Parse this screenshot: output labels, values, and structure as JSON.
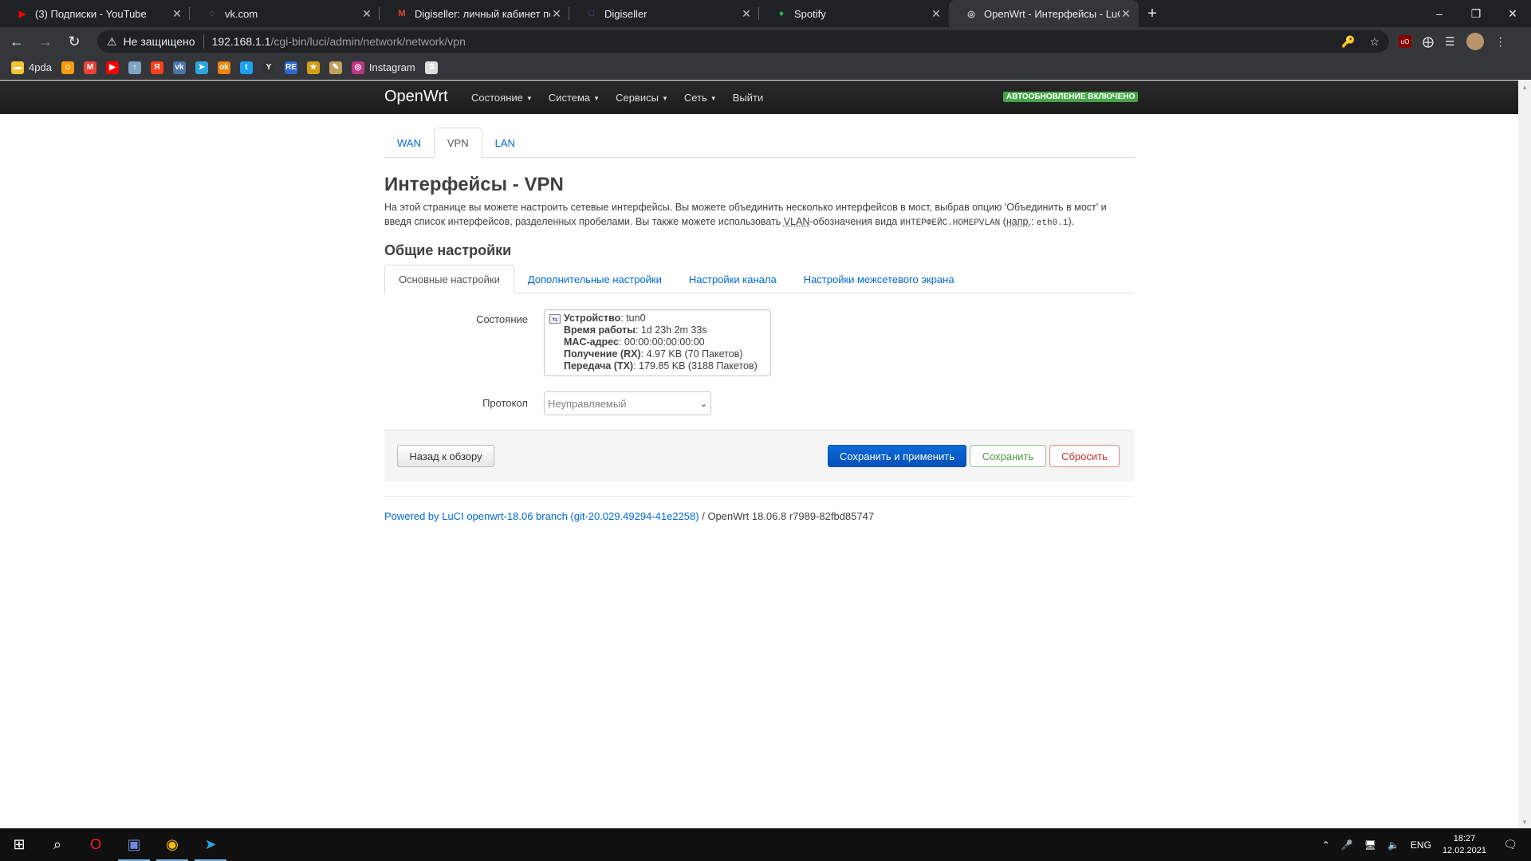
{
  "browser": {
    "tabs": [
      {
        "title": "(3) Подписки - YouTube",
        "icon": "youtube-icon",
        "color": "#ff0000"
      },
      {
        "title": "vk.com",
        "icon": "loading-icon",
        "color": "#9aa0a6"
      },
      {
        "title": "Digiseller: личный кабинет поку",
        "icon": "gmail-icon",
        "color": "#ea4335"
      },
      {
        "title": "Digiseller",
        "icon": "digiseller-icon",
        "color": "#3a5bbf"
      },
      {
        "title": "Spotify",
        "icon": "spotify-icon",
        "color": "#1db954"
      },
      {
        "title": "OpenWrt - Интерфейсы - LuCI",
        "icon": "openwrt-icon",
        "color": "#cccccc"
      }
    ],
    "address": {
      "security_label": "Не защищено",
      "host": "192.168.1.1",
      "path": "/cgi-bin/luci/admin/network/network/vpn"
    },
    "bookmarks": [
      {
        "label": "4pda",
        "icon": "folder-icon",
        "color": "#f4c430"
      },
      {
        "label": "",
        "icon": "sticker-icon",
        "color": "#f39c12"
      },
      {
        "label": "",
        "icon": "gmail-icon",
        "color": "#ea4335"
      },
      {
        "label": "",
        "icon": "youtube-icon",
        "color": "#ff0000"
      },
      {
        "label": "",
        "icon": "upload-icon",
        "color": "#7fa4c4"
      },
      {
        "label": "",
        "icon": "yandex-icon",
        "color": "#fc3f1d"
      },
      {
        "label": "",
        "icon": "vk-icon",
        "color": "#4a76a8"
      },
      {
        "label": "",
        "icon": "telegram-icon",
        "color": "#2ca5e0"
      },
      {
        "label": "",
        "icon": "odnoklassniki-icon",
        "color": "#ee8208"
      },
      {
        "label": "",
        "icon": "twitter-icon",
        "color": "#1da1f2"
      },
      {
        "label": "",
        "icon": "y-icon",
        "color": "#333333"
      },
      {
        "label": "",
        "icon": "re-icon",
        "color": "#3366cc"
      },
      {
        "label": "",
        "icon": "emblem-icon",
        "color": "#d4a017"
      },
      {
        "label": "",
        "icon": "pen-icon",
        "color": "#c0a060"
      },
      {
        "label": "Instagram",
        "icon": "instagram-icon",
        "color": "#c13584"
      },
      {
        "label": "",
        "icon": "flask-icon",
        "color": "#dddddd"
      }
    ]
  },
  "luci": {
    "brand": "OpenWrt",
    "menu": [
      {
        "label": "Состояние",
        "caret": true
      },
      {
        "label": "Система",
        "caret": true
      },
      {
        "label": "Сервисы",
        "caret": true
      },
      {
        "label": "Сеть",
        "caret": true
      },
      {
        "label": "Выйти",
        "caret": false
      }
    ],
    "autoupdate_badge": "АВТООБНОВЛЕНИЕ ВКЛЮЧЕНО",
    "iface_tabs": [
      "WAN",
      "VPN",
      "LAN"
    ],
    "iface_tab_active": "VPN",
    "title": "Интерфейсы - VPN",
    "description": {
      "part1": "На этой странице вы можете настроить сетевые интерфейсы. Вы можете объединить несколько интерфейсов в мост, выбрав опцию 'Объединить в мост' и введя список интерфейсов, разделенных пробелами. Вы также можете использовать ",
      "vlan": "VLAN",
      "part2": "-обозначения вида ",
      "code1": "ИНТЕРФЕЙС.НОМЕРVLAN",
      "part3": " (",
      "abbr": "напр.",
      "part4": ": ",
      "code2": "eth0.1",
      "part5": ")."
    },
    "section_title": "Общие настройки",
    "sub_tabs": [
      "Основные настройки",
      "Дополнительные настройки",
      "Настройки канала",
      "Настройки межсетевого экрана"
    ],
    "sub_tab_active": "Основные настройки",
    "status_label": "Состояние",
    "status": [
      {
        "key": "Устройство",
        "value": "tun0"
      },
      {
        "key": "Время работы",
        "value": "1d 23h 2m 33s"
      },
      {
        "key": "MAC-адрес",
        "value": "00:00:00:00:00:00"
      },
      {
        "key": "Получение (RX)",
        "value": "4.97 KB (70 Пакетов)"
      },
      {
        "key": "Передача (TX)",
        "value": "179.85 KB (3188 Пакетов)"
      }
    ],
    "protocol_label": "Протокол",
    "protocol_value": "Неуправляемый",
    "buttons": {
      "back": "Назад к обзору",
      "save_apply": "Сохранить и применить",
      "save": "Сохранить",
      "reset": "Сбросить"
    },
    "footer": {
      "link": "Powered by LuCI openwrt-18.06 branch (git-20.029.49294-41e2258)",
      "text": " / OpenWrt 18.06.8 r7989-82fbd85747"
    }
  },
  "taskbar": {
    "apps": [
      {
        "icon": "windows-start-icon"
      },
      {
        "icon": "search-icon"
      },
      {
        "icon": "opera-icon"
      },
      {
        "icon": "discord-icon"
      },
      {
        "icon": "chrome-icon"
      },
      {
        "icon": "telegram-icon"
      }
    ],
    "lang": "ENG",
    "time": "18:27",
    "date": "12.02.2021"
  }
}
